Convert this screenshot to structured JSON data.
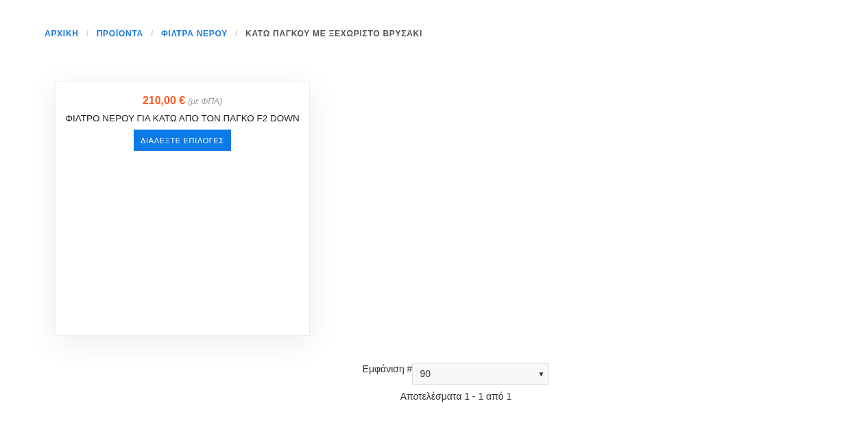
{
  "breadcrumb": [
    {
      "label": "ΑΡΧΙΚΗ",
      "kind": "link"
    },
    {
      "label": "ΠΡΟΪΟΝΤΑ",
      "kind": "link",
      "separator": "/"
    },
    {
      "label": "ΦΙΛΤΡΑ ΝΕΡΟΥ",
      "kind": "link",
      "separator": "/"
    },
    {
      "label": "ΚΑΤΩ ΠΑΓΚΟΥ ΜΕ ΞΕΧΩΡΙΣΤΟ ΒΡΥΣΑΚΙ",
      "kind": "current",
      "separator": "/"
    }
  ],
  "products": [
    {
      "price": "210,00 €",
      "price_note": "(με ΦΠΑ)",
      "title": "ΦΙΛΤΡΟ ΝΕΡΟΥ ΓΙΑ ΚΑΤΩ ΑΠΟ ΤΟΝ ΠΑΓΚΟ F2 DOWN",
      "button": "ΔΙΑΛΕΞΤΕ ΕΠΙΛΟΓΕΣ"
    }
  ],
  "pagination": {
    "display_label": "Εμφάνιση #",
    "per_page": "90",
    "arrow": "▼",
    "results": "Αποτελέσματα 1 - 1 από 1"
  }
}
